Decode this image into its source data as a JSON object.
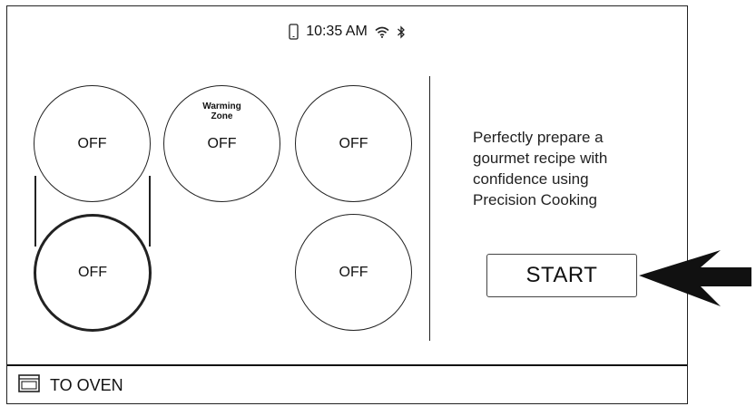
{
  "status_bar": {
    "time": "10:35 AM",
    "icons": [
      "phone-icon",
      "wifi-icon",
      "bluetooth-icon"
    ]
  },
  "cooktop": {
    "burners": [
      {
        "id": "left-front",
        "state": "OFF",
        "label": ""
      },
      {
        "id": "center-warming",
        "state": "OFF",
        "label_line1": "Warming",
        "label_line2": "Zone"
      },
      {
        "id": "right-rear",
        "state": "OFF",
        "label": ""
      },
      {
        "id": "left-rear",
        "state": "OFF",
        "label": "",
        "selected": true
      },
      {
        "id": "right-front",
        "state": "OFF",
        "label": ""
      }
    ]
  },
  "promo": {
    "text": "Perfectly prepare a gourmet recipe with confidence using Precision Cooking"
  },
  "start_button": {
    "label": "START"
  },
  "bottom_bar": {
    "to_oven_label": "TO OVEN",
    "icon": "oven-icon"
  },
  "colors": {
    "line": "#222222",
    "background": "#ffffff",
    "arrow": "#111111"
  }
}
